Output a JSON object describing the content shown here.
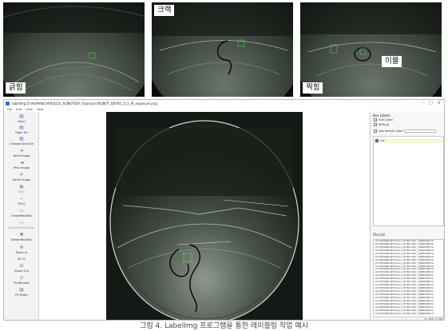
{
  "thumbnails": [
    {
      "label": "긁힘"
    },
    {
      "label": "크랙"
    },
    {
      "labels": [
        "이물",
        "찍힘"
      ]
    }
  ],
  "window": {
    "title": "labelImg D:\\HUMANCARE\\0221_ROBOTDEF_Exposure\\ROBOT_DEF00_211_IR_exposure.png",
    "menu": [
      "File",
      "Edit",
      "View",
      "Help"
    ],
    "controls": [
      "–",
      "□",
      "×"
    ]
  },
  "toolbar": [
    {
      "label": "Open",
      "icon": "folder-open-icon"
    },
    {
      "label": "Open Dir",
      "icon": "folder-icon"
    },
    {
      "label": "Change Save Dir",
      "icon": "folder-save-icon"
    },
    {
      "label": "Next Image",
      "icon": "arrow-right-icon"
    },
    {
      "label": "Prev Image",
      "icon": "arrow-left-icon"
    },
    {
      "label": "Verify Image",
      "icon": "check-icon"
    },
    {
      "label": "Save",
      "icon": "save-icon"
    },
    {
      "label": "YOLO",
      "icon": "format-icon"
    },
    {
      "label": "CreateRectBox",
      "icon": "rect-icon"
    },
    {
      "label": "DuplicateRectBox",
      "icon": "duplicate-icon"
    },
    {
      "label": "DeleteRectBox",
      "icon": "delete-icon"
    },
    {
      "label": "Zoom In",
      "icon": "zoom-in-icon"
    },
    {
      "label": "81 %",
      "icon": ""
    },
    {
      "label": "Zoom Out",
      "icon": "zoom-out-icon"
    },
    {
      "label": "Fit Window",
      "icon": "fit-window-icon"
    },
    {
      "label": "Fit Width",
      "icon": "fit-width-icon"
    }
  ],
  "right_panel": {
    "box_labels_title": "Box Labels",
    "edit_label": "Edit Label",
    "difficult": "difficult",
    "use_default_label": "Use default label",
    "labels": [
      "crk"
    ],
    "file_list_title": "File List",
    "files": [
      "D:\\HUMANCARE\\0221_ROBOTDEF_Exposure\\10",
      "D:\\HUMANCARE\\0221_ROBOTDEF_Exposure\\10",
      "D:\\HUMANCARE\\0221_ROBOTDEF_Exposure\\10",
      "D:\\HUMANCARE\\0221_ROBOTDEF_Exposure\\10",
      "D:\\HUMANCARE\\0221_ROBOTDEF_Exposure\\10",
      "D:\\HUMANCARE\\0221_ROBOTDEF_Exposure\\10",
      "D:\\HUMANCARE\\0221_ROBOTDEF_Exposure\\10",
      "D:\\HUMANCARE\\0221_ROBOTDEF_Exposure\\10",
      "D:\\HUMANCARE\\0221_ROBOTDEF_Exposure\\10",
      "D:\\HUMANCARE\\0221_ROBOTDEF_Exposure\\10",
      "D:\\HUMANCARE\\0221_ROBOTDEF_Exposure\\10",
      "D:\\HUMANCARE\\0221_ROBOTDEF_Exposure\\10",
      "D:\\HUMANCARE\\0221_ROBOTDEF_Exposure\\10",
      "D:\\HUMANCARE\\0221_ROBOTDEF_Exposure\\10",
      "D:\\HUMANCARE\\0221_ROBOTDEF_Exposure\\10",
      "D:\\HUMANCARE\\0221_ROBOTDEF_Exposure\\10",
      "D:\\HUMANCARE\\0221_ROBOTDEF_Exposure\\10",
      "D:\\HUMANCARE\\0221_ROBOTDEF_Exposure\\10",
      "D:\\HUMANCARE\\0221_ROBOTDEF_Exposure\\10",
      "D:\\HUMANCARE\\0221_ROBOTDEF_Exposure\\10",
      "D:\\HUMANCARE\\0221_ROBOTDEF_Exposure\\10",
      "D:\\HUMANCARE\\0221_ROBOTDEF_Exposure\\10",
      "D:\\HUMANCARE\\0221_ROBOTDEF_Exposure\\10",
      "D:\\HUMANCARE\\0221_ROBOTDEF_Exposure\\10"
    ]
  },
  "status": "X: 354; Y: 463",
  "caption": "그림 4. LabelImg 프로그램을 통한 레이블링 작업 예시",
  "colors": {
    "accent": "#3a6fc4",
    "box": "#33dd33",
    "label_bg": "#f5f7d9"
  }
}
